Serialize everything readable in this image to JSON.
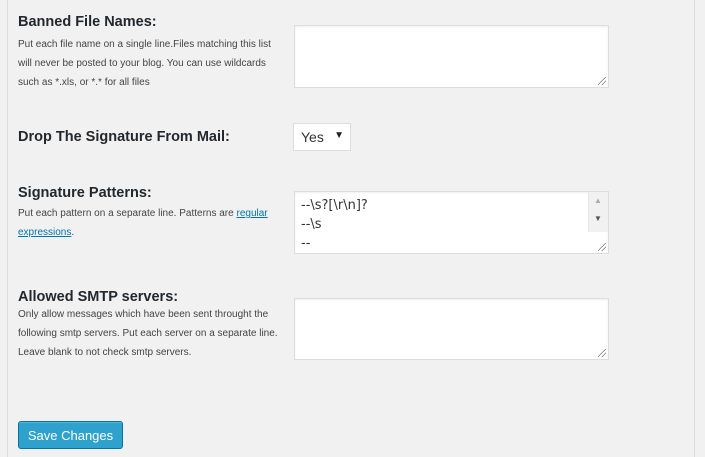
{
  "settings": [
    {
      "label": "Banned File Names:",
      "description": "Put each file name on a single line.Files matching this list will never be posted to your blog. You can use wildcards such as *.xls, or *.* for all files",
      "value": ""
    },
    {
      "label": "Drop The Signature From Mail:",
      "selected": "Yes"
    },
    {
      "label": "Signature Patterns:",
      "description_prefix": "Put each pattern on a separate line. Patterns are ",
      "description_link": "regular expressions",
      "description_suffix": ".",
      "lines": [
        "--\\s?[\\r\\n]?",
        "--\\s",
        "--"
      ]
    },
    {
      "label": "Allowed SMTP servers:",
      "description": "Only allow messages which have been sent throught the following smtp servers. Put each server on a separate line. Leave blank to not check smtp servers.",
      "value": ""
    }
  ],
  "save_button": "Save Changes",
  "colors": {
    "background": "#f1f1f1",
    "button": "#2ea2cc",
    "link": "#0073aa"
  }
}
